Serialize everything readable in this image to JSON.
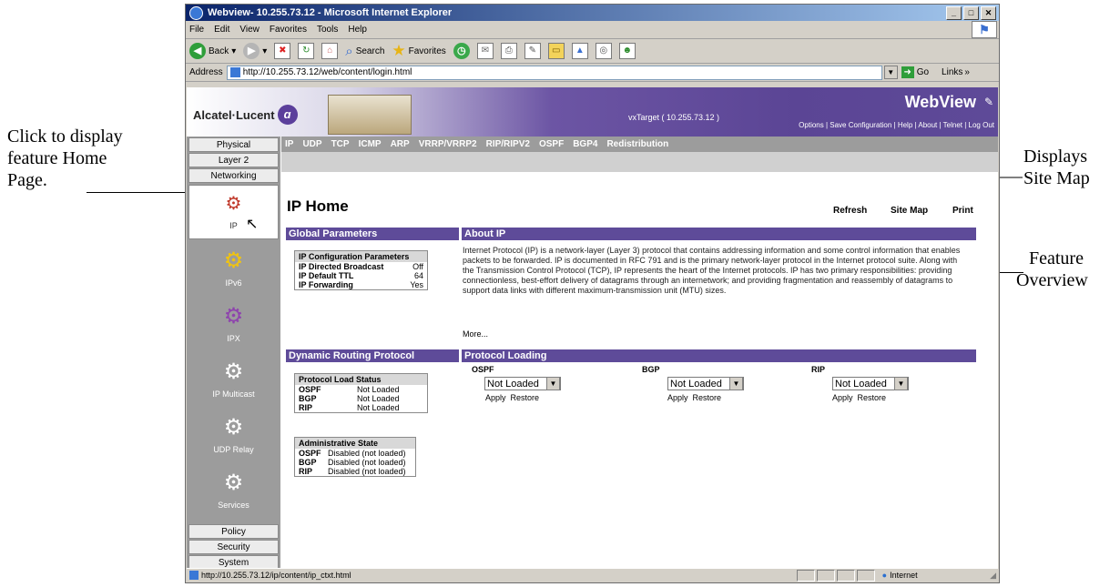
{
  "callouts": {
    "home_page": [
      "Click to display",
      "feature Home",
      "Page."
    ],
    "site_map": [
      "Displays",
      "Site Map"
    ],
    "overview": [
      "Feature",
      "Overview"
    ]
  },
  "browser": {
    "title": "Webview- 10.255.73.12 - Microsoft Internet Explorer",
    "menu": [
      "File",
      "Edit",
      "View",
      "Favorites",
      "Tools",
      "Help"
    ],
    "toolbar": {
      "back": "Back",
      "search": "Search",
      "favorites": "Favorites"
    },
    "address_label": "Address",
    "address_value": "http://10.255.73.12/web/content/login.html",
    "go": "Go",
    "links": "Links",
    "status_url": "http://10.255.73.12/ip/content/ip_ctxt.html",
    "status_zone": "Internet"
  },
  "banner": {
    "brand": "Alcatel·Lucent",
    "app": "WebView",
    "target": "vxTarget ( 10.255.73.12 )",
    "links": "Options  |  Save Configuration  |  Help  |  About  |  Telnet  |  Log Out"
  },
  "nav": {
    "top": [
      "Physical",
      "Layer 2",
      "Networking"
    ],
    "icons": [
      {
        "label": "IP",
        "icon": "ip-icon"
      },
      {
        "label": "IPv6",
        "icon": "ipv6-icon"
      },
      {
        "label": "IPX",
        "icon": "ipx-icon"
      },
      {
        "label": "IP Multicast",
        "icon": "ip-multicast-icon"
      },
      {
        "label": "UDP Relay",
        "icon": "udp-relay-icon"
      },
      {
        "label": "Services",
        "icon": "services-icon"
      }
    ],
    "bottom": [
      "Policy",
      "Security",
      "System"
    ]
  },
  "tabs": [
    "IP",
    "UDP",
    "TCP",
    "ICMP",
    "ARP",
    "VRRP/VRRP2",
    "RIP/RIPV2",
    "OSPF",
    "BGP4",
    "Redistribution"
  ],
  "page": {
    "title": "IP Home",
    "refresh": "Refresh",
    "sitemap": "Site Map",
    "print": "Print"
  },
  "global_params": {
    "header": "Global Parameters",
    "table_title": "IP Configuration Parameters",
    "rows": [
      {
        "k": "IP Directed Broadcast",
        "v": "Off"
      },
      {
        "k": "IP Default TTL",
        "v": "64"
      },
      {
        "k": "IP Forwarding",
        "v": "Yes"
      }
    ]
  },
  "about": {
    "header": "About IP",
    "text": "Internet Protocol (IP) is a network-layer (Layer 3) protocol that contains addressing information and some control information that enables packets to be forwarded. IP is documented in RFC 791 and is the primary network-layer protocol in the Internet protocol suite. Along with the Transmission Control Protocol (TCP), IP represents the heart of the Internet protocols. IP has two primary responsibilities: providing connectionless, best-effort delivery of datagrams through an internetwork; and providing fragmentation and reassembly of datagrams to support data links with different maximum-transmission unit (MTU) sizes.",
    "more": "More..."
  },
  "dynamic": {
    "header": "Dynamic Routing Protocol",
    "load_title": "Protocol Load Status",
    "load_rows": [
      {
        "k": "OSPF",
        "v": "Not Loaded"
      },
      {
        "k": "BGP",
        "v": "Not Loaded"
      },
      {
        "k": "RIP",
        "v": "Not Loaded"
      }
    ],
    "admin_title": "Administrative State",
    "admin_rows": [
      {
        "k": "OSPF",
        "v": "Disabled (not loaded)"
      },
      {
        "k": "BGP",
        "v": "Disabled (not loaded)"
      },
      {
        "k": "RIP",
        "v": "Disabled (not loaded)"
      }
    ]
  },
  "loading": {
    "header": "Protocol Loading",
    "protocols": [
      {
        "name": "OSPF",
        "value": "Not Loaded"
      },
      {
        "name": "BGP",
        "value": "Not Loaded"
      },
      {
        "name": "RIP",
        "value": "Not Loaded"
      }
    ],
    "apply": "Apply",
    "restore": "Restore"
  }
}
